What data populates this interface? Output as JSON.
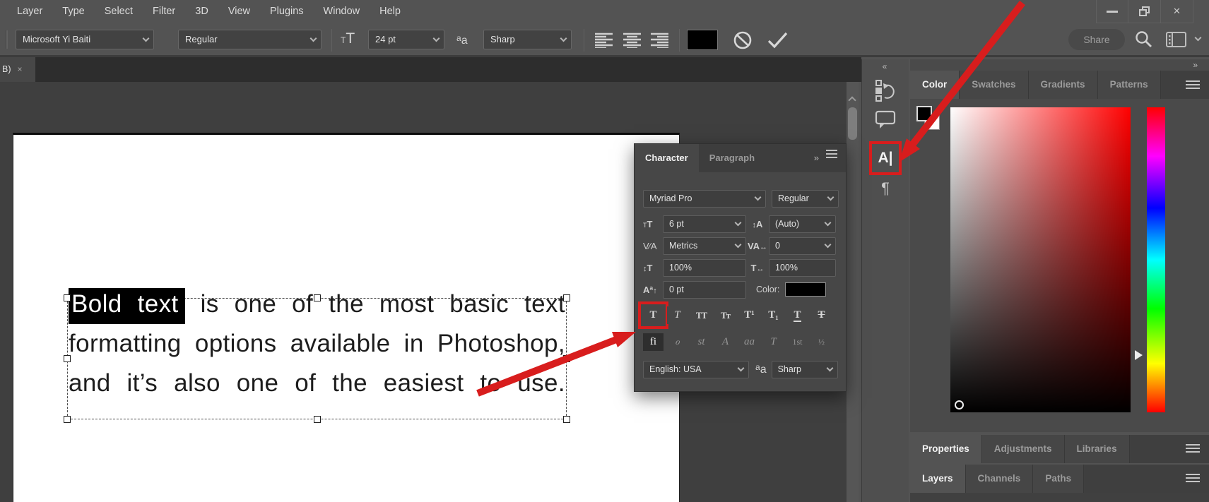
{
  "menu": {
    "items": [
      "Layer",
      "Type",
      "Select",
      "Filter",
      "3D",
      "View",
      "Plugins",
      "Window",
      "Help"
    ]
  },
  "titlebar": {
    "close_glyph": "✕"
  },
  "options_bar": {
    "font_family": "Microsoft Yi Baiti",
    "font_style": "Regular",
    "size_icon_big": "T",
    "size_icon_small": "T",
    "font_size": "24 pt",
    "aa_icon_a1": "a",
    "aa_icon_a2": "a",
    "anti_alias": "Sharp",
    "share_label": "Share"
  },
  "doc_tab": {
    "label": "B)",
    "close_glyph": "×"
  },
  "canvas_text": {
    "selected": "Bold text",
    "line1_rest": " is one of the most basic text",
    "line2": "formatting options available in Photoshop,",
    "line3": "and it’s also one of the easiest to use."
  },
  "character_panel": {
    "tab_character": "Character",
    "tab_paragraph": "Paragraph",
    "expand_glyph": "»",
    "font_family": "Myriad Pro",
    "font_style": "Regular",
    "font_size": "6 pt",
    "leading": "(Auto)",
    "kerning": "Metrics",
    "tracking": "0",
    "vertical_scale": "100%",
    "horizontal_scale": "100%",
    "baseline_shift": "0 pt",
    "color_label": "Color:",
    "icons": {
      "T": "T",
      "A": "A",
      "kerning": "V⁄A",
      "VA": "VA",
      "Aa": "Aª",
      "updown": "↕",
      "leftright": "↔",
      "up": "↑"
    },
    "style_buttons": [
      "T",
      "T",
      "TT",
      "Tᴛ",
      "T¹",
      "T₁",
      "T",
      "T"
    ],
    "opentype_buttons": [
      "fi",
      "ℴ",
      "st",
      "A",
      "aa",
      "T",
      "1st",
      "½"
    ],
    "language": "English: USA",
    "anti_alias": "Sharp"
  },
  "dock_strip": {
    "collapse_glyph": "«",
    "character_icon": "A|",
    "paragraph_icon": "¶"
  },
  "right_dock": {
    "expand_glyph": "»",
    "color_tabs": [
      "Color",
      "Swatches",
      "Gradients",
      "Patterns"
    ],
    "properties_tabs": [
      "Properties",
      "Adjustments",
      "Libraries"
    ],
    "layers_tabs": [
      "Layers",
      "Channels",
      "Paths"
    ]
  },
  "colors": {
    "annotation_red": "#d81d1d",
    "foreground": "#000000",
    "background": "#ffffff"
  }
}
